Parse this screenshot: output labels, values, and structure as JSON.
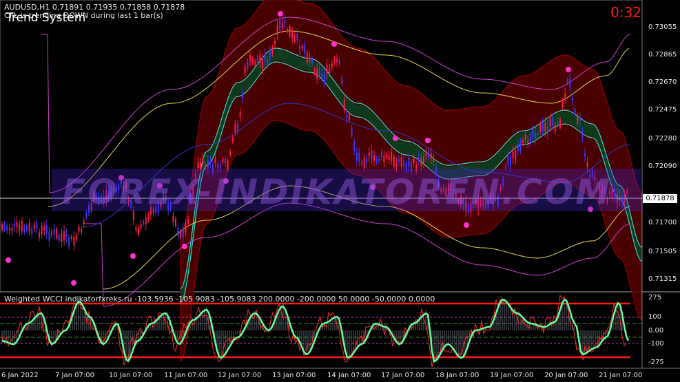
{
  "header": {
    "symbol_line": "AUDUSD,H1  0.71891 0.71935 0.71858 0.71878",
    "trend_message": "CFL is trending DOWN during last 1 bar(s)",
    "system_title": "Trend System",
    "timer": "0:32"
  },
  "watermark": "FOREX-INDIKATOREN.COM",
  "price_axis": {
    "labels": [
      "0.73055",
      "0.72865",
      "0.72670",
      "0.72475",
      "0.72280",
      "0.72090",
      "0.71700",
      "0.71505",
      "0.71315"
    ],
    "current_price": "0.71878"
  },
  "indicator": {
    "title": "Weighted WCCI indikatorfxreks.ru -103.5936 -105.9083 -105.9083 200.0000 -200.0000 50.0000 -50.0000 0.0000",
    "axis_labels": [
      "275",
      "100",
      "0.00",
      "-100",
      "-275"
    ]
  },
  "time_axis": {
    "labels": [
      "6 Jan 2022",
      "7 Jan 07:00",
      "10 Jan 07:00",
      "11 Jan 07:00",
      "12 Jan 07:00",
      "13 Jan 07:00",
      "14 Jan 07:00",
      "17 Jan 07:00",
      "18 Jan 07:00",
      "19 Jan 07:00",
      "20 Jan 07:00",
      "21 Jan 07:00"
    ]
  },
  "colors": {
    "background": "#000000",
    "bull_candle": "#3a3aff",
    "bear_candle": "#ff1a4a",
    "channel_fill": "#550000",
    "trend_band": "#0c3a1a",
    "dot": "#ff33cc",
    "cci_line": "#66ff99",
    "level_line": "#ff1a1a"
  }
}
